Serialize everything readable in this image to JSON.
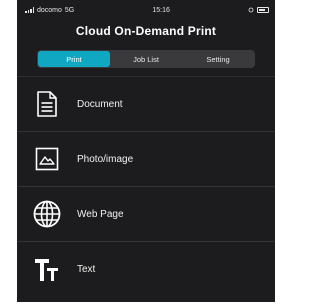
{
  "status": {
    "carrier": "docomo",
    "network": "5G",
    "time": "15:16"
  },
  "app": {
    "title": "Cloud On-Demand Print"
  },
  "tabs": [
    {
      "label": "Print",
      "active": true
    },
    {
      "label": "Job List",
      "active": false
    },
    {
      "label": "Setting",
      "active": false
    }
  ],
  "items": [
    {
      "label": "Document",
      "icon": "document-icon"
    },
    {
      "label": "Photo/image",
      "icon": "photo-icon"
    },
    {
      "label": "Web Page",
      "icon": "globe-icon"
    },
    {
      "label": "Text",
      "icon": "text-icon"
    }
  ],
  "colors": {
    "accent": "#10a7c2",
    "background": "#1c1c1e"
  }
}
